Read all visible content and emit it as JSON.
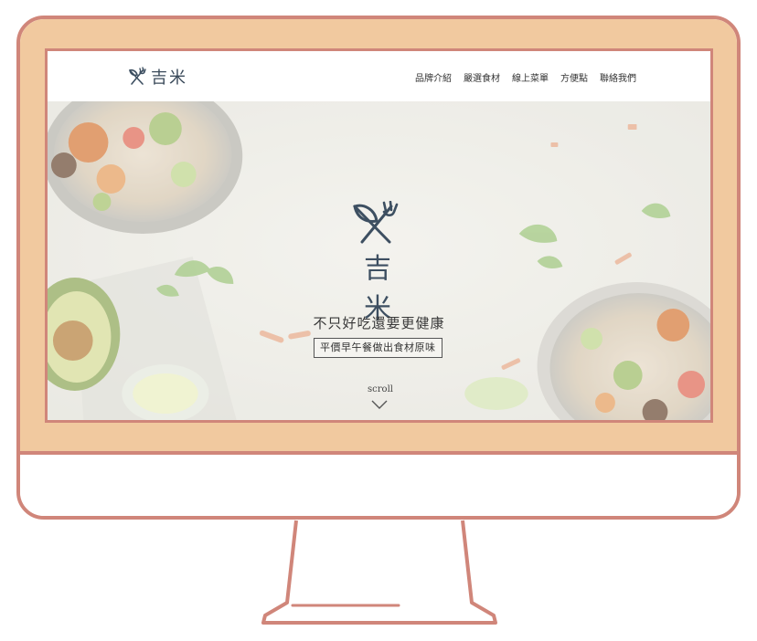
{
  "brand": {
    "name": "吉米"
  },
  "nav": {
    "items": [
      {
        "label": "品牌介紹"
      },
      {
        "label": "嚴選食材"
      },
      {
        "label": "線上菜單"
      },
      {
        "label": "方便點"
      },
      {
        "label": "聯絡我們"
      }
    ]
  },
  "hero": {
    "brand": "吉米",
    "slogan": "不只好吃還要更健康",
    "tagline": "平價早午餐做出食材原味",
    "scroll_label": "scroll",
    "icons": {
      "logo": "leaf-fork-icon",
      "scroll": "chevron-down-icon"
    }
  },
  "colors": {
    "frame_outline": "#d0867a",
    "bezel": "#f1c99f",
    "logo_ink": "#3d4f61"
  }
}
